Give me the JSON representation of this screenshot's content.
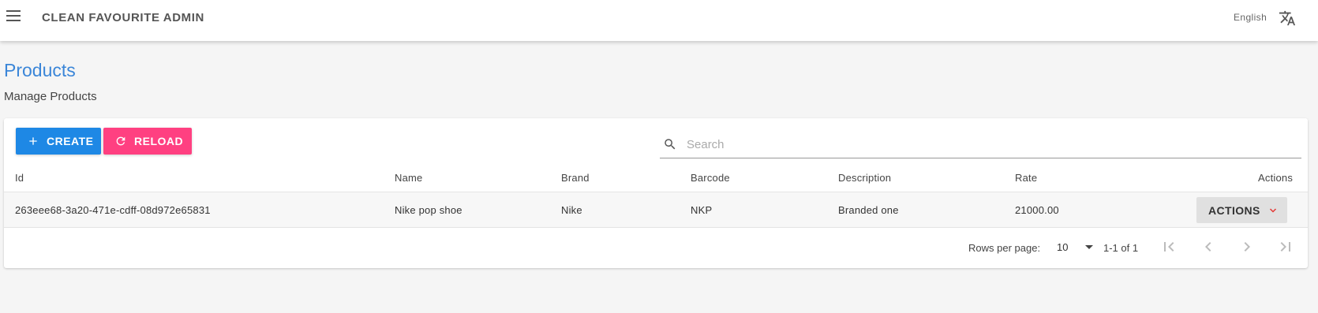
{
  "app": {
    "title": "CLEAN FAVOURITE ADMIN",
    "language": "English"
  },
  "page": {
    "title": "Products",
    "subtitle": "Manage Products"
  },
  "toolbar": {
    "create_label": "CREATE",
    "reload_label": "RELOAD"
  },
  "search": {
    "placeholder": "Search",
    "value": ""
  },
  "table": {
    "columns": [
      "Id",
      "Name",
      "Brand",
      "Barcode",
      "Description",
      "Rate",
      "Actions"
    ],
    "rows": [
      {
        "id": "263eee68-3a20-471e-cdff-08d972e65831",
        "name": "Nike pop shoe",
        "brand": "Nike",
        "barcode": "NKP",
        "description": "Branded one",
        "rate": "21000.00",
        "actions_label": "ACTIONS"
      }
    ]
  },
  "pagination": {
    "rows_per_page_label": "Rows per page:",
    "rows_per_page": "10",
    "range": "1-1 of 1"
  },
  "icons": {
    "menu": "menu-icon",
    "translate": "translate-icon",
    "create": "plus-icon",
    "reload": "refresh-icon",
    "search": "search-icon",
    "actions": "chevron-down-icon",
    "first": "first-page-icon",
    "prev": "chevron-left-icon",
    "next": "chevron-right-icon",
    "last": "last-page-icon"
  },
  "colors": {
    "primary": "#1e88e5",
    "secondary": "#ff4081",
    "title": "#3b86d8",
    "chevron": "#e53935"
  }
}
